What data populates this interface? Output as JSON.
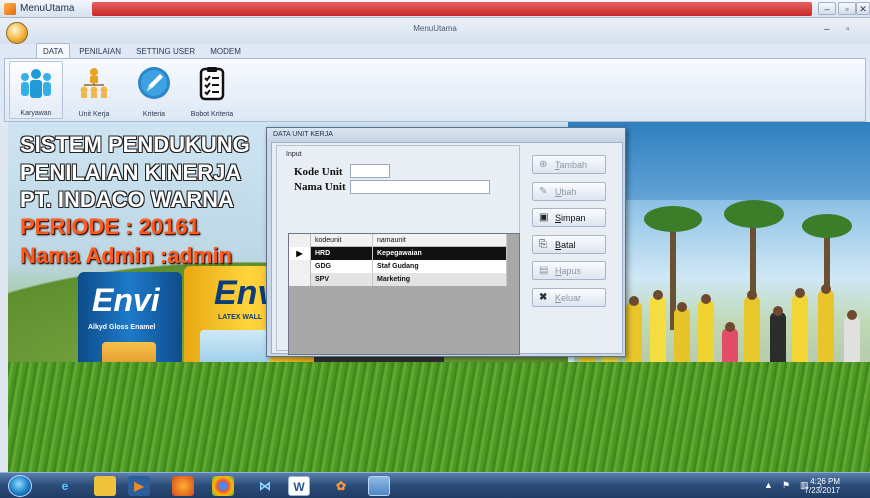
{
  "window": {
    "app_title": "MenuUtama",
    "form_title": "MenuUtama",
    "controls": {
      "minimize": "–",
      "maximize": "▫",
      "close": "✕"
    }
  },
  "ribbon": {
    "tabs": [
      {
        "label": "DATA",
        "active": true
      },
      {
        "label": "PENILAIAN"
      },
      {
        "label": "SETTING USER"
      },
      {
        "label": "MODEM"
      }
    ],
    "buttons": [
      {
        "label": "Karyawan",
        "icon": "people-icon"
      },
      {
        "label": "Unit Kerja",
        "icon": "org-chart-icon"
      },
      {
        "label": "Kriteria",
        "icon": "pencil-icon"
      },
      {
        "label": "Bobot Kriteria",
        "icon": "checklist-icon"
      }
    ]
  },
  "background": {
    "line1": "SISTEM PENDUKUNG",
    "line2": "PENILAIAN KINERJA",
    "line3": "PT. INDACO WARNA",
    "period": "PERIODE : 20161",
    "admin": "Nama Admin :admin",
    "can1_brand": "Envi",
    "can1_sub": "Alkyd Gloss Enamel",
    "can2_brand": "Envi",
    "can2_sub": "LATEX WALL"
  },
  "dialog": {
    "title": "DATA UNIT KERJA",
    "group_label": "Input",
    "fields": {
      "kode_label": "Kode Unit",
      "kode_value": "",
      "nama_label": "Nama Unit",
      "nama_value": ""
    },
    "grid": {
      "columns": [
        "kodeunit",
        "namaunit"
      ],
      "rows": [
        {
          "kodeunit": "HRD",
          "namaunit": "Kepegawaian",
          "selected": true
        },
        {
          "kodeunit": "GDG",
          "namaunit": "Staf Gudang"
        },
        {
          "kodeunit": "SPV",
          "namaunit": "Marketing"
        }
      ]
    },
    "actions": [
      {
        "label": "Tambah",
        "key": "T",
        "rest": "ambah",
        "icon": "plus-circle-icon",
        "enabled": false
      },
      {
        "label": "Ubah",
        "key": "U",
        "rest": "bah",
        "icon": "edit-icon",
        "enabled": false
      },
      {
        "label": "Simpan",
        "key": "S",
        "rest": "impan",
        "icon": "save-icon",
        "enabled": true
      },
      {
        "label": "Batal",
        "key": "B",
        "rest": "atal",
        "icon": "cancel-doc-icon",
        "enabled": true
      },
      {
        "label": "Hapus",
        "key": "H",
        "rest": "apus",
        "icon": "delete-doc-icon",
        "enabled": false
      },
      {
        "label": "Keluar",
        "key": "K",
        "rest": "eluar",
        "icon": "close-x-icon",
        "enabled": false
      }
    ]
  },
  "taskbar": {
    "time": "4:26 PM",
    "date": "7/23/2017"
  }
}
